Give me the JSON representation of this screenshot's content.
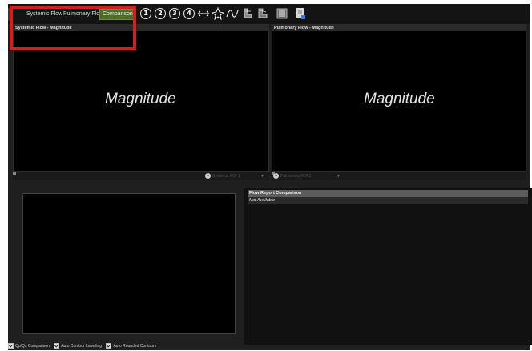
{
  "toolbar": {
    "tabs": [
      "Systemic Flow",
      "Pulmonary Flow",
      "Comparison"
    ],
    "active_tab": "Comparison",
    "number_buttons": [
      "1",
      "2",
      "3",
      "4"
    ],
    "icons": [
      "horizontal-measure-icon",
      "star-contour-icon",
      "curve-icon",
      "vessel-tool-icon",
      "vessel-tool-alt-icon",
      "image-export-icon",
      "report-export-icon"
    ]
  },
  "viewports": {
    "left": {
      "title": "Systemic Flow - Magnitude",
      "overlay": "Magnitude",
      "series_num": "1",
      "series_label": "Systemic ROI 1"
    },
    "right": {
      "title": "Pulmonary Flow - Magnitude",
      "overlay": "Magnitude",
      "series_num": "1",
      "series_label": "Pulmonary ROI 1"
    }
  },
  "report": {
    "header": "Flow Report Comparison",
    "row": "Not Available"
  },
  "statusbar": {
    "options": [
      "Qp/Qs Comparison",
      "Auto Contour Labelling",
      "Auto Rounded Contours"
    ]
  },
  "colors": {
    "accent_tab": "#4e6b2a",
    "highlight_box": "#d21f1f",
    "crescent": "#3a4a1c"
  }
}
